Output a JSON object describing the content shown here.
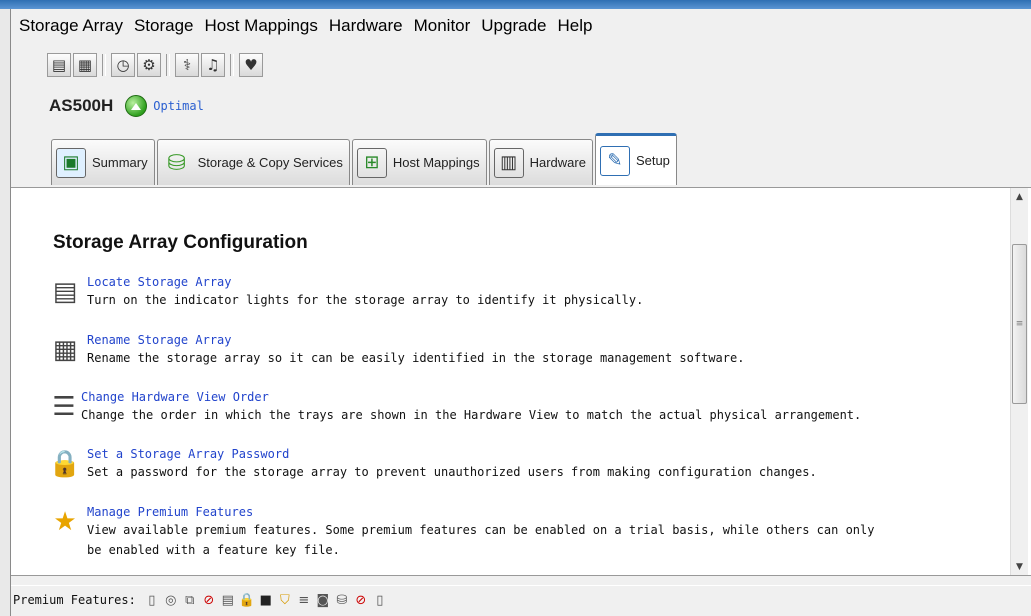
{
  "menu": [
    "Storage Array",
    "Storage",
    "Host Mappings",
    "Hardware",
    "Monitor",
    "Upgrade",
    "Help"
  ],
  "toolbar": {
    "icons": [
      "storage-array-icon",
      "array-view-icon",
      "clock-icon",
      "settings-gears-icon",
      "support-icon",
      "alarm-bell-icon",
      "heart-icon"
    ]
  },
  "array": {
    "name": "AS500H",
    "status": "Optimal",
    "status_color": "#2fa01e"
  },
  "tabs": [
    {
      "label": "Summary",
      "icon": "summary-icon"
    },
    {
      "label": "Storage & Copy Services",
      "icon": "storage-copy-services-icon"
    },
    {
      "label": "Host Mappings",
      "icon": "host-mappings-icon"
    },
    {
      "label": "Hardware",
      "icon": "hardware-icon"
    },
    {
      "label": "Setup",
      "icon": "setup-icon"
    }
  ],
  "active_tab": "Setup",
  "section": {
    "title": "Storage Array Configuration"
  },
  "tasks": [
    {
      "title": "Locate Storage Array",
      "desc": [
        "Turn on the indicator lights for the storage array to identify it physically."
      ],
      "icon": "locate-array-icon"
    },
    {
      "title": "Rename Storage Array",
      "desc": [
        "Rename the storage array so it can be easily identified in the storage management software."
      ],
      "icon": "rename-array-icon"
    },
    {
      "title": "Change Hardware View Order",
      "desc": [
        "Change the order in which the trays are shown in the Hardware View to match the actual physical arrangement."
      ],
      "icon": "hardware-view-order-icon"
    },
    {
      "title": "Set a Storage Array Password",
      "desc": [
        "Set a password for the storage array to prevent unauthorized users from making configuration changes."
      ],
      "icon": "password-lock-icon"
    },
    {
      "title": "Manage Premium Features",
      "desc": [
        "View available premium features. Some premium features can be enabled on a trial basis, while others can only",
        "be enabled with a feature key file."
      ],
      "icon": "premium-features-star-icon"
    }
  ],
  "statusbar": {
    "label": "Premium Features:",
    "icons": [
      "trash-icon",
      "snapshot-icon",
      "copy-icon",
      "disabled-feature-icon",
      "drive-icon",
      "lock-icon",
      "terminal-icon",
      "shield-icon",
      "notes-icon",
      "camera-icon",
      "database-icon",
      "disabled-mirror-icon",
      "volume-icon"
    ]
  }
}
